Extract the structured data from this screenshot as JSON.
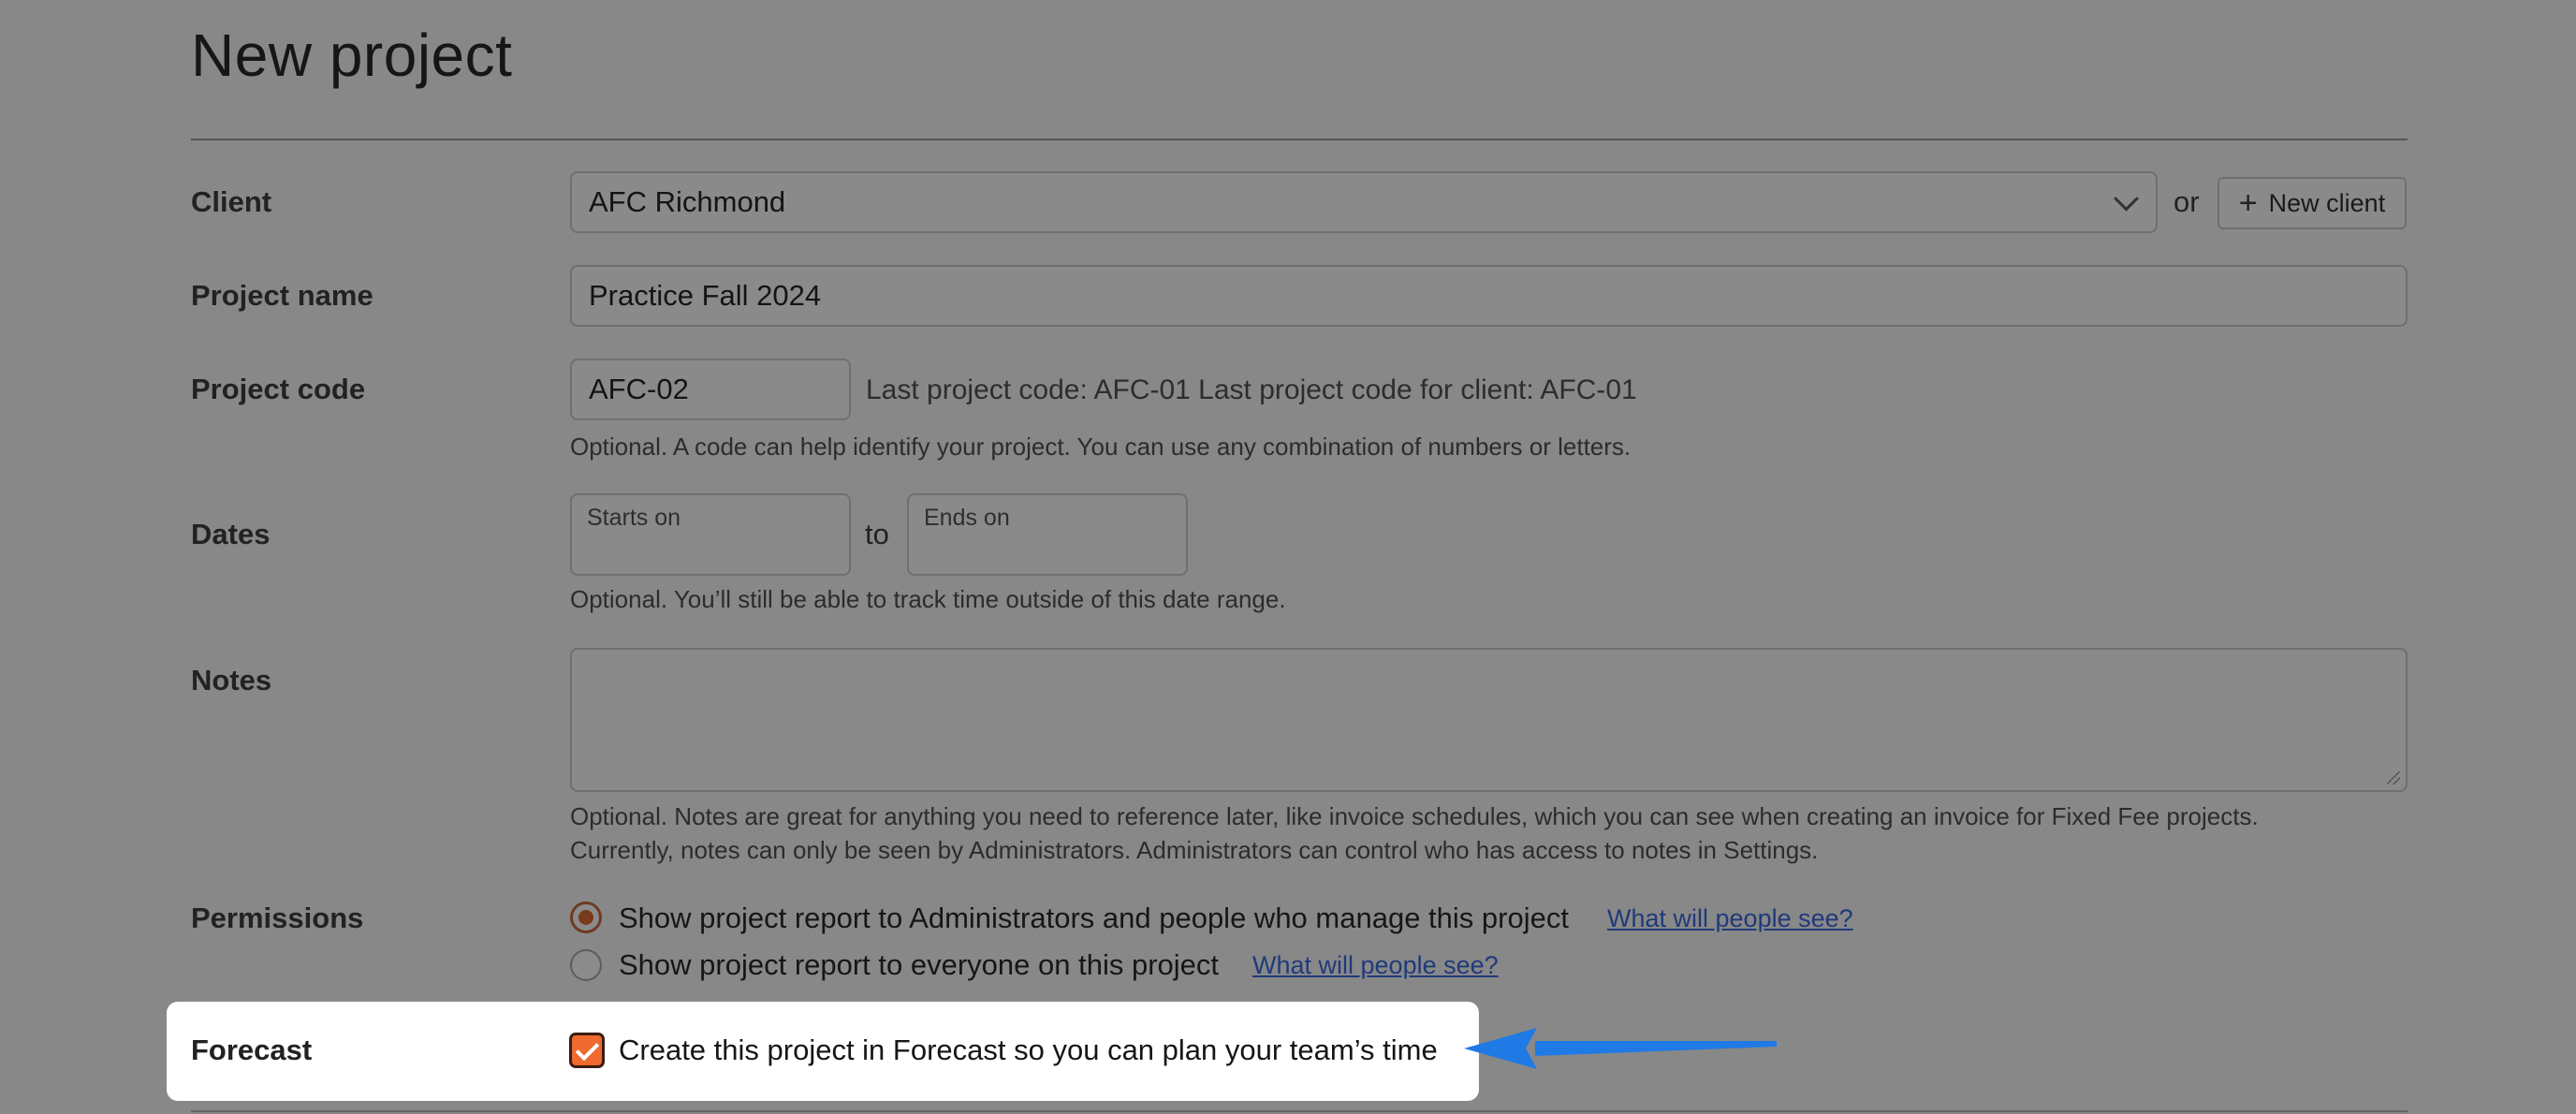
{
  "page": {
    "title": "New project"
  },
  "client": {
    "label": "Client",
    "value": "AFC Richmond",
    "or": "or",
    "new_client_label": "New client",
    "new_client_icon": "plus-icon"
  },
  "project_name": {
    "label": "Project name",
    "value": "Practice Fall 2024"
  },
  "project_code": {
    "label": "Project code",
    "value": "AFC-02",
    "last_codes": "Last project code: AFC-01 Last project code for client: AFC-01",
    "hint": "Optional. A code can help identify your project. You can use any combination of numbers or letters."
  },
  "dates": {
    "label": "Dates",
    "start_placeholder": "Starts on",
    "to": "to",
    "end_placeholder": "Ends on",
    "hint": "Optional. You’ll still be able to track time outside of this date range."
  },
  "notes": {
    "label": "Notes",
    "value": "",
    "hint_line1": "Optional. Notes are great for anything you need to reference later, like invoice schedules, which you can see when creating an invoice for Fixed Fee projects.",
    "hint_line2": "Currently, notes can only be seen by Administrators. Administrators can control who has access to notes in Settings."
  },
  "permissions": {
    "label": "Permissions",
    "options": [
      {
        "text": "Show project report to Administrators and people who manage this project",
        "link": "What will people see?",
        "selected": true
      },
      {
        "text": "Show project report to everyone on this project",
        "link": "What will people see?",
        "selected": false
      }
    ]
  },
  "forecast": {
    "label": "Forecast",
    "checkbox_text": "Create this project in Forecast so you can plan your team’s time",
    "checked": true
  },
  "colors": {
    "accent": "#ee6a2f",
    "arrow": "#1f7ae6",
    "background": "#888888"
  }
}
